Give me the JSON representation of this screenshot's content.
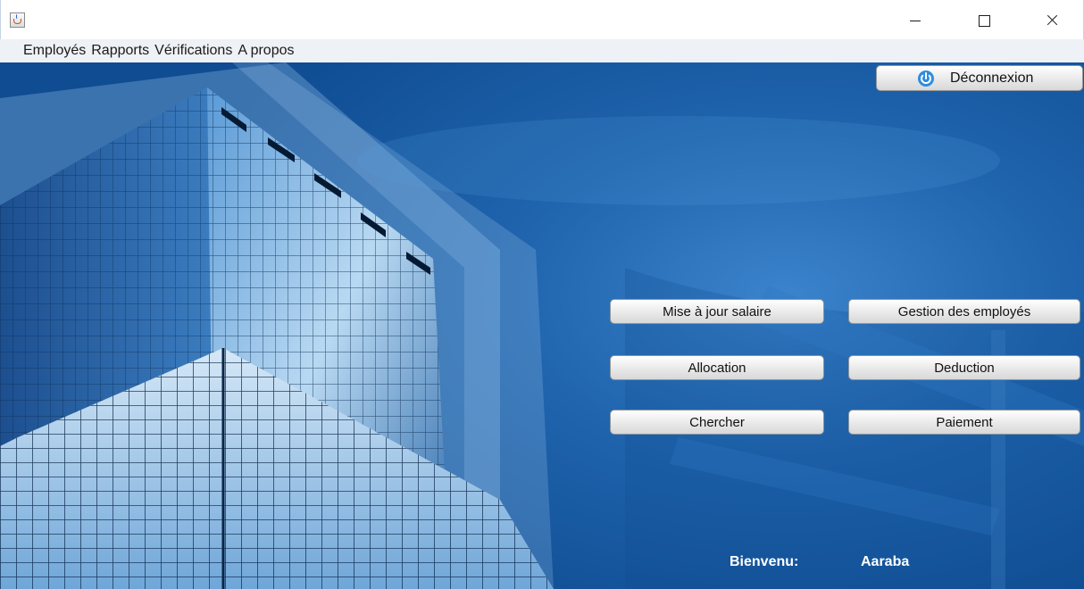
{
  "window": {
    "app_icon": "java-cup-icon",
    "controls": [
      "minimize-icon",
      "maximize-icon",
      "close-icon"
    ]
  },
  "menubar": {
    "items": [
      {
        "label": "Employés"
      },
      {
        "label": "Rapports"
      },
      {
        "label": "Vérifications"
      },
      {
        "label": "A propos"
      }
    ]
  },
  "header": {
    "logout_label": "Déconnexion",
    "logout_icon": "power-icon"
  },
  "actions": {
    "update_salary": "Mise à jour salaire",
    "manage_employees": "Gestion des employés",
    "allocation": "Allocation",
    "deduction": "Deduction",
    "search": "Chercher",
    "payment": "Paiement"
  },
  "footer": {
    "welcome_label": "Bienvenu:",
    "username": "Aaraba"
  },
  "colors": {
    "background_blue": "#1f64ad",
    "power_icon": "#2f8de0",
    "welcome_text": "#ffffff"
  }
}
